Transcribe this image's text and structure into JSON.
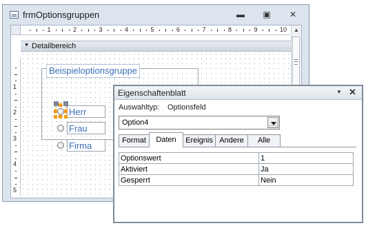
{
  "form_window": {
    "title": "frmOptionsgruppen",
    "ruler_numbers": [
      "1",
      "2",
      "3",
      "4",
      "5",
      "6",
      "7",
      "8",
      "9",
      "10"
    ],
    "vruler_numbers": [
      "1",
      "2",
      "3",
      "4",
      "5"
    ],
    "section_label": "Detailbereich",
    "option_group_label": "Beispieloptionsgruppe",
    "options": [
      "Herr",
      "Frau",
      "Firma"
    ]
  },
  "property_sheet": {
    "title": "Eigenschaftenblatt",
    "selection_type_label": "Auswahltyp:",
    "selection_type_value": "Optionsfeld",
    "selected_object": "Option4",
    "tabs": [
      "Format",
      "Daten",
      "Ereignis",
      "Andere",
      "Alle"
    ],
    "active_tab": "Daten",
    "properties": [
      {
        "name": "Optionswert",
        "value": "1"
      },
      {
        "name": "Aktiviert",
        "value": "Ja"
      },
      {
        "name": "Gesperrt",
        "value": "Nein"
      }
    ]
  },
  "colors": {
    "selection_handle": "#f39c12",
    "label_text": "#3b6fb6"
  }
}
